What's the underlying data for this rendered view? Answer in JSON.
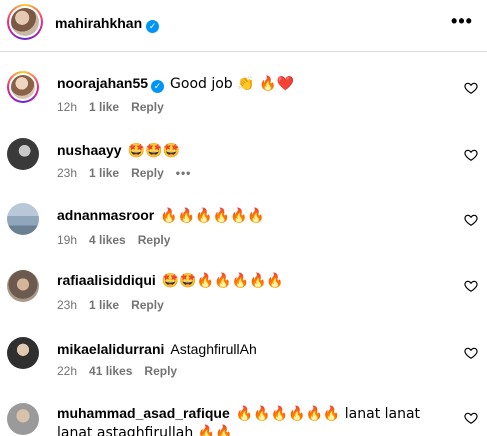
{
  "header": {
    "username": "mahirahkhan",
    "verified": true,
    "more_glyph": "•••"
  },
  "comments": [
    {
      "username": "noorajahan55",
      "verified": true,
      "text": "Good job 👏 🔥❤️",
      "time": "12h",
      "likes": "1 like",
      "reply": "Reply",
      "avatar_color": "#b89478"
    },
    {
      "username": "nushaayy",
      "verified": false,
      "text": "🤩🤩🤩",
      "time": "23h",
      "likes": "1 like",
      "reply": "Reply",
      "more": "•••",
      "avatar_color": "#3a3a3a"
    },
    {
      "username": "adnanmasroor",
      "verified": false,
      "text": "🔥🔥🔥🔥🔥🔥",
      "time": "19h",
      "likes": "4 likes",
      "reply": "Reply",
      "avatar_color": "#8aa0b8"
    },
    {
      "username": "rafiaalisiddiqui",
      "verified": false,
      "text": "🤩🤩🔥🔥🔥🔥🔥",
      "time": "23h",
      "likes": "1 like",
      "reply": "Reply",
      "avatar_color": "#6d5a4e"
    },
    {
      "username": "mikaelalidurrani",
      "verified": false,
      "text": "AstaghfirullAh",
      "time": "22h",
      "likes": "41 likes",
      "reply": "Reply",
      "avatar_color": "#4a4a4a"
    },
    {
      "username": "muhammad_asad_rafique",
      "verified": false,
      "text": "🔥🔥🔥🔥🔥🔥 lanat lanat lanat astaghfirullah 🔥🔥",
      "avatar_color": "#9a9a9a"
    }
  ],
  "colors": {
    "accent_verified": "#0095f6",
    "meta_gray": "#737373",
    "divider": "#dbdbdb"
  },
  "icons": {
    "heart": "heart-outline-icon",
    "more": "more-horizontal-icon",
    "verified": "verified-badge-icon"
  }
}
